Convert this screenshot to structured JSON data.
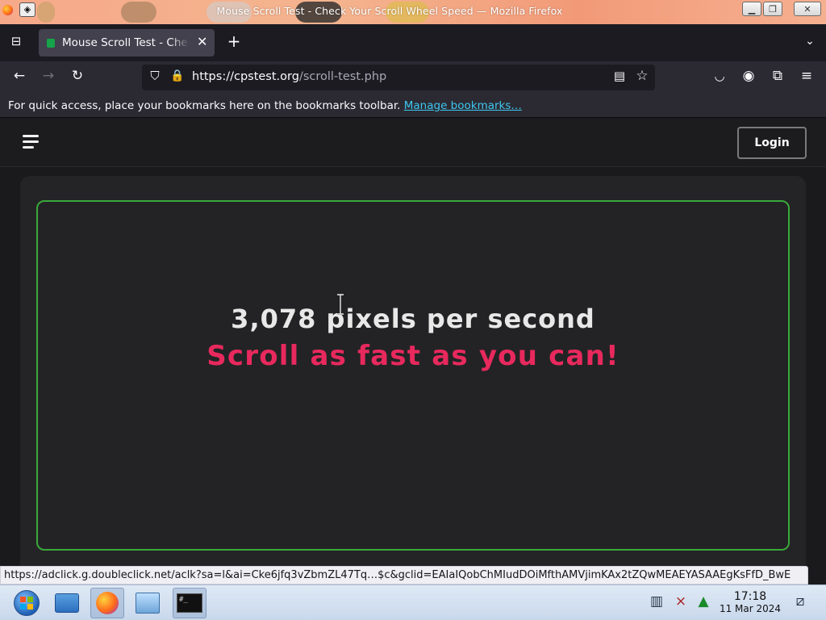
{
  "window": {
    "title": "Mouse Scroll Test - Check Your Scroll Wheel Speed — Mozilla Firefox"
  },
  "tabs": [
    {
      "label": "Mouse Scroll Test - Check Your Scroll Wheel Speed"
    }
  ],
  "navbar": {
    "url_host": "https://cpstest.org",
    "url_path": "/scroll-test.php"
  },
  "bookmarks": {
    "message": "For quick access, place your bookmarks here on the bookmarks toolbar.",
    "manage_link": "Manage bookmarks…"
  },
  "site": {
    "login_label": "Login",
    "speed_text": "3,078 pixels per second",
    "instruction": "Scroll as fast as you can!"
  },
  "status_link": "https://adclick.g.doubleclick.net/aclk?sa=l&ai=Cke6jfq3vZbmZL47Tq…$c&gclid=EAIaIQobChMIudDOiMfthAMVjimKAx2tZQwMEAEYASAAEgKsFfD_BwE",
  "taskbar": {
    "time": "17:18",
    "date": "11 Mar 2024"
  },
  "colors": {
    "instruction": "#e8295d",
    "box_border": "#3aa83a",
    "link": "#3ec7f0"
  }
}
